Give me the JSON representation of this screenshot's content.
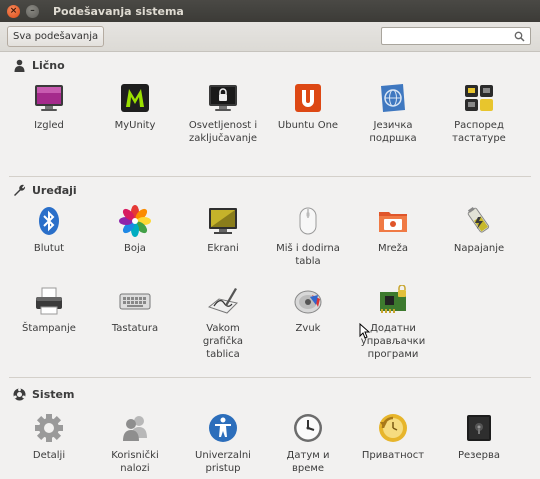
{
  "window": {
    "title": "Podešavanja sistema",
    "close_glyph": "×",
    "minimize_glyph": "–"
  },
  "toolbar": {
    "all_settings_label": "Sva podešavanja",
    "search_value": "",
    "search_placeholder": ""
  },
  "sections": {
    "personal": {
      "title": "Lično",
      "icon": "person-icon",
      "items": [
        {
          "label": "Izgled",
          "icon": "appearance-icon"
        },
        {
          "label": "MyUnity",
          "icon": "myunity-icon"
        },
        {
          "label": "Osvetljenost i zaključavanje",
          "icon": "brightness-lock-icon"
        },
        {
          "label": "Ubuntu One",
          "icon": "ubuntu-one-icon"
        },
        {
          "label": "Језичка подршка",
          "icon": "language-support-icon"
        },
        {
          "label": "Распоред тастатуре",
          "icon": "keyboard-layout-icon"
        }
      ]
    },
    "hardware": {
      "title": "Uređaji",
      "icon": "wrench-icon",
      "items": [
        {
          "label": "Blutut",
          "icon": "bluetooth-icon"
        },
        {
          "label": "Boja",
          "icon": "color-icon"
        },
        {
          "label": "Ekrani",
          "icon": "displays-icon"
        },
        {
          "label": "Miš i dodirna tabla",
          "icon": "mouse-icon"
        },
        {
          "label": "Mreža",
          "icon": "network-icon"
        },
        {
          "label": "Napajanje",
          "icon": "power-icon"
        },
        {
          "label": "Štampanje",
          "icon": "printer-icon"
        },
        {
          "label": "Tastatura",
          "icon": "keyboard-icon"
        },
        {
          "label": "Vakom grafička tablica",
          "icon": "wacom-tablet-icon"
        },
        {
          "label": "Zvuk",
          "icon": "sound-icon"
        },
        {
          "label": "Додатни управљачки програми",
          "icon": "additional-drivers-icon"
        }
      ]
    },
    "system": {
      "title": "Sistem",
      "icon": "system-icon",
      "items": [
        {
          "label": "Detalji",
          "icon": "details-icon"
        },
        {
          "label": "Korisnički nalozi",
          "icon": "user-accounts-icon"
        },
        {
          "label": "Univerzalni pristup",
          "icon": "universal-access-icon"
        },
        {
          "label": "Датум и време",
          "icon": "clock-icon"
        },
        {
          "label": "Приватност",
          "icon": "privacy-icon"
        },
        {
          "label": "Резерва",
          "icon": "backup-icon"
        }
      ]
    }
  }
}
